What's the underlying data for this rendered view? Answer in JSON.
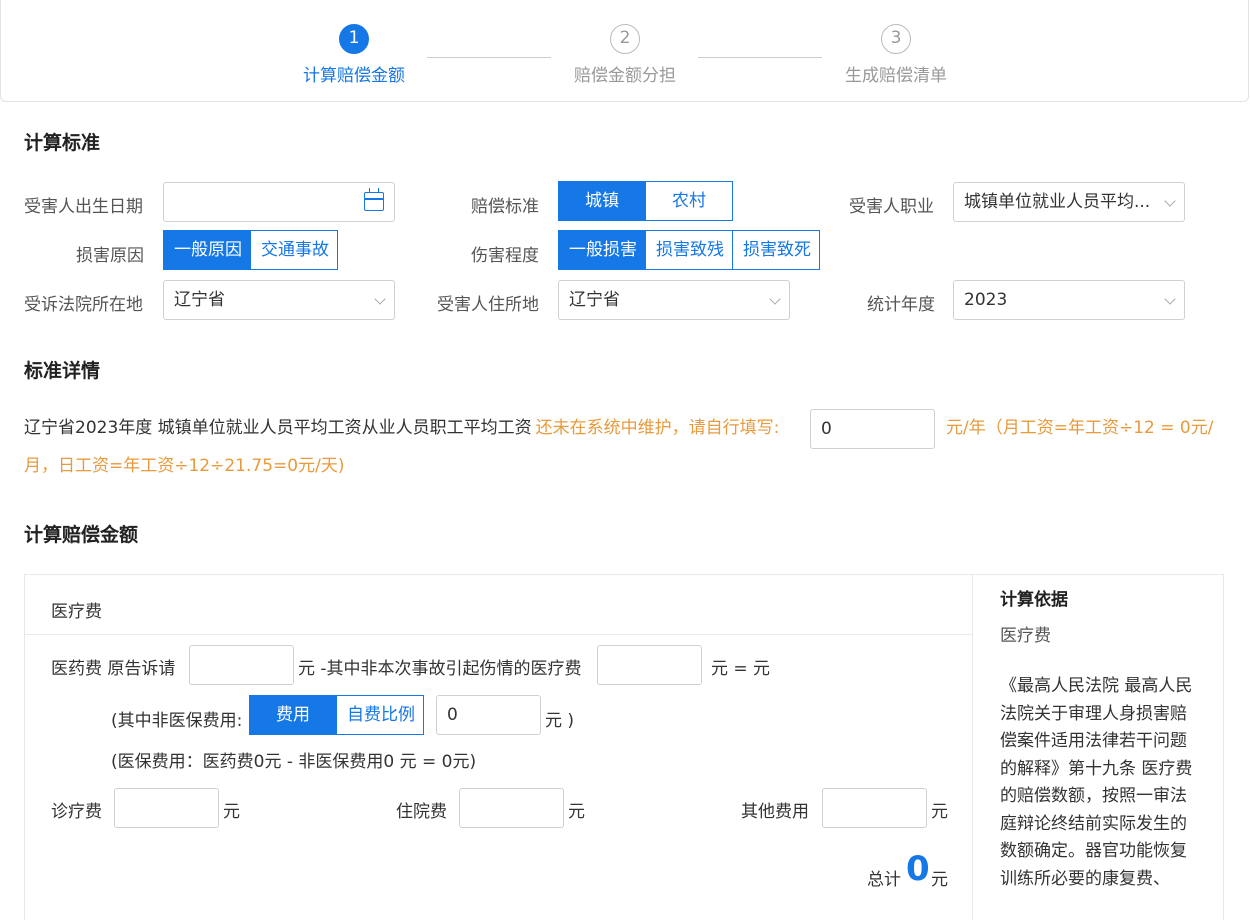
{
  "steps": [
    {
      "num": "1",
      "label": "计算赔偿金额"
    },
    {
      "num": "2",
      "label": "赔偿金额分担"
    },
    {
      "num": "3",
      "label": "生成赔偿清单"
    }
  ],
  "sections": {
    "standard": "计算标准",
    "detail": "标准详情",
    "calc": "计算赔偿金额"
  },
  "form": {
    "birth_label": "受害人出生日期",
    "birth_value": "",
    "comp_std_label": "赔偿标准",
    "comp_std_options": [
      "城镇",
      "农村"
    ],
    "occupation_label": "受害人职业",
    "occupation_value": "城镇单位就业人员平均...",
    "cause_label": "损害原因",
    "cause_options": [
      "一般原因",
      "交通事故"
    ],
    "injury_label": "伤害程度",
    "injury_options": [
      "一般损害",
      "损害致残",
      "损害致死"
    ],
    "court_label": "受诉法院所在地",
    "court_value": "辽宁省",
    "residence_label": "受害人住所地",
    "residence_value": "辽宁省",
    "year_label": "统计年度",
    "year_value": "2023"
  },
  "detail": {
    "black_text": "辽宁省2023年度 城镇单位就业人员平均工资从业人员职工平均工资",
    "orange_text": "还未在系统中维护，请自行填写:",
    "input_value": "0",
    "line1_tail": "元/年（月工资=年工资÷12 = 0元/",
    "line2": "月，日工资=年工资÷12÷21.75=0元/天)"
  },
  "calc": {
    "header": "医疗费",
    "row1_label": "医药费 原告诉请",
    "row1_mid": "元 -其中非本次事故引起伤情的医疗费",
    "row1_tail": "元 = 元",
    "row2_label": "(其中非医保费用:",
    "row2_options": [
      "费用",
      "自费比例"
    ],
    "row2_value": "0",
    "row2_tail": "元 )",
    "row3_text": "(医保费用：医药费0元 - 非医保费用0 元 = 0元)",
    "diag_label": "诊疗费",
    "hosp_label": "住院费",
    "other_label": "其他费用",
    "unit": "元",
    "total_label": "总计",
    "total_value": "0",
    "total_unit": "元"
  },
  "basis": {
    "title": "计算依据",
    "subtitle": "医疗费",
    "body": "《最高人民法院 最高人民法院关于审理人身损害赔偿案件适用法律若干问题的解释》第十九条 医疗费的赔偿数额，按照一审法庭辩论终结前实际发生的数额确定。器官功能恢复训练所必要的康复费、"
  },
  "colors": {
    "primary": "#1677e6",
    "warning": "#e89a3c"
  }
}
